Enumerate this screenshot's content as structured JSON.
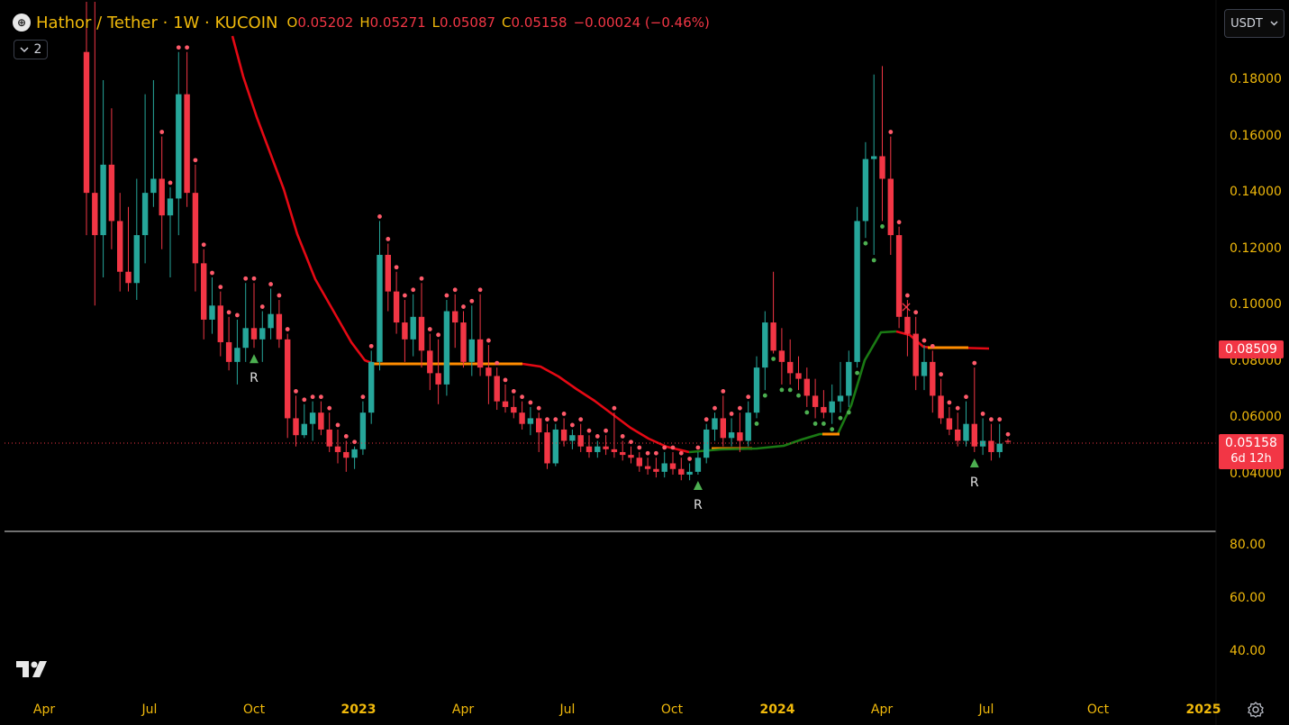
{
  "header": {
    "symbol_icon": "hathor-logo-icon",
    "title": "Hathor / Tether · 1W · KUCOIN",
    "open_label": "O",
    "open_value": "0.05202",
    "high_label": "H",
    "high_value": "0.05271",
    "low_label": "L",
    "low_value": "0.05087",
    "close_label": "C",
    "close_value": "0.05158",
    "change": "−0.00024 (−0.46%)"
  },
  "indicator_toggle": {
    "icon": "chevron-down-icon",
    "count": "2"
  },
  "currency_selector": {
    "value": "USDT",
    "icon": "chevron-down-icon"
  },
  "price_axis": [
    "0.18000",
    "0.16000",
    "0.14000",
    "0.12000",
    "0.10000",
    "0.08000",
    "0.06000",
    "0.04000"
  ],
  "price_tags": {
    "indicator": "0.08509",
    "last_price": "0.05158",
    "countdown": "6d 12h"
  },
  "oscillator_axis": [
    "80.00",
    "60.00",
    "40.00"
  ],
  "time_axis": [
    {
      "label": "Apr",
      "bold": false
    },
    {
      "label": "Jul",
      "bold": false
    },
    {
      "label": "Oct",
      "bold": false
    },
    {
      "label": "2023",
      "bold": true
    },
    {
      "label": "Apr",
      "bold": false
    },
    {
      "label": "Jul",
      "bold": false
    },
    {
      "label": "Oct",
      "bold": false
    },
    {
      "label": "2024",
      "bold": true
    },
    {
      "label": "Apr",
      "bold": false
    },
    {
      "label": "Jul",
      "bold": false
    },
    {
      "label": "Oct",
      "bold": false
    },
    {
      "label": "2025",
      "bold": true
    }
  ],
  "markers": {
    "reversal_label": "R",
    "cross_label": "×"
  },
  "colors": {
    "up": "#26a69a",
    "down": "#f23645",
    "accent": "#f0b90b",
    "trend_down": "#e50914",
    "trend_up": "#1a7a14",
    "trend_flat": "#ff8c00"
  },
  "chart_data": {
    "type": "candlestick",
    "interval": "1W",
    "y_range": [
      0.03,
      0.19
    ],
    "candles": [
      [
        0.19,
        0.25,
        0.125,
        0.14
      ],
      [
        0.14,
        0.23,
        0.1,
        0.125
      ],
      [
        0.125,
        0.18,
        0.11,
        0.15
      ],
      [
        0.15,
        0.17,
        0.12,
        0.13
      ],
      [
        0.13,
        0.14,
        0.105,
        0.112
      ],
      [
        0.112,
        0.135,
        0.105,
        0.108
      ],
      [
        0.108,
        0.145,
        0.102,
        0.125
      ],
      [
        0.125,
        0.175,
        0.115,
        0.14
      ],
      [
        0.14,
        0.18,
        0.135,
        0.145
      ],
      [
        0.145,
        0.16,
        0.12,
        0.132
      ],
      [
        0.132,
        0.142,
        0.11,
        0.138
      ],
      [
        0.138,
        0.19,
        0.125,
        0.175
      ],
      [
        0.175,
        0.19,
        0.135,
        0.14
      ],
      [
        0.14,
        0.15,
        0.105,
        0.115
      ],
      [
        0.115,
        0.12,
        0.088,
        0.095
      ],
      [
        0.095,
        0.11,
        0.09,
        0.1
      ],
      [
        0.1,
        0.105,
        0.082,
        0.087
      ],
      [
        0.087,
        0.096,
        0.077,
        0.08
      ],
      [
        0.08,
        0.095,
        0.072,
        0.085
      ],
      [
        0.085,
        0.108,
        0.08,
        0.092
      ],
      [
        0.092,
        0.108,
        0.085,
        0.088
      ],
      [
        0.088,
        0.098,
        0.08,
        0.092
      ],
      [
        0.092,
        0.106,
        0.088,
        0.097
      ],
      [
        0.097,
        0.102,
        0.085,
        0.088
      ],
      [
        0.088,
        0.09,
        0.053,
        0.06
      ],
      [
        0.06,
        0.068,
        0.05,
        0.054
      ],
      [
        0.054,
        0.065,
        0.053,
        0.058
      ],
      [
        0.058,
        0.066,
        0.052,
        0.062
      ],
      [
        0.062,
        0.066,
        0.054,
        0.056
      ],
      [
        0.056,
        0.062,
        0.048,
        0.05
      ],
      [
        0.05,
        0.056,
        0.044,
        0.048
      ],
      [
        0.048,
        0.052,
        0.041,
        0.046
      ],
      [
        0.046,
        0.05,
        0.042,
        0.049
      ],
      [
        0.049,
        0.066,
        0.047,
        0.062
      ],
      [
        0.062,
        0.084,
        0.058,
        0.08
      ],
      [
        0.08,
        0.13,
        0.077,
        0.118
      ],
      [
        0.118,
        0.122,
        0.098,
        0.105
      ],
      [
        0.105,
        0.112,
        0.09,
        0.094
      ],
      [
        0.094,
        0.102,
        0.08,
        0.088
      ],
      [
        0.088,
        0.104,
        0.082,
        0.096
      ],
      [
        0.096,
        0.108,
        0.078,
        0.084
      ],
      [
        0.084,
        0.09,
        0.07,
        0.076
      ],
      [
        0.076,
        0.088,
        0.065,
        0.072
      ],
      [
        0.072,
        0.102,
        0.068,
        0.098
      ],
      [
        0.098,
        0.104,
        0.085,
        0.094
      ],
      [
        0.094,
        0.098,
        0.078,
        0.08
      ],
      [
        0.08,
        0.1,
        0.075,
        0.088
      ],
      [
        0.088,
        0.104,
        0.075,
        0.078
      ],
      [
        0.078,
        0.086,
        0.065,
        0.075
      ],
      [
        0.075,
        0.078,
        0.063,
        0.066
      ],
      [
        0.066,
        0.072,
        0.062,
        0.064
      ],
      [
        0.064,
        0.068,
        0.06,
        0.062
      ],
      [
        0.062,
        0.066,
        0.056,
        0.058
      ],
      [
        0.058,
        0.064,
        0.054,
        0.06
      ],
      [
        0.06,
        0.062,
        0.048,
        0.055
      ],
      [
        0.055,
        0.058,
        0.042,
        0.044
      ],
      [
        0.044,
        0.058,
        0.043,
        0.056
      ],
      [
        0.056,
        0.06,
        0.05,
        0.052
      ],
      [
        0.052,
        0.056,
        0.049,
        0.054
      ],
      [
        0.054,
        0.058,
        0.048,
        0.05
      ],
      [
        0.05,
        0.054,
        0.046,
        0.048
      ],
      [
        0.048,
        0.052,
        0.046,
        0.05
      ],
      [
        0.05,
        0.054,
        0.047,
        0.049
      ],
      [
        0.049,
        0.062,
        0.046,
        0.048
      ],
      [
        0.048,
        0.052,
        0.045,
        0.047
      ],
      [
        0.047,
        0.05,
        0.044,
        0.046
      ],
      [
        0.046,
        0.048,
        0.041,
        0.043
      ],
      [
        0.043,
        0.046,
        0.04,
        0.042
      ],
      [
        0.042,
        0.046,
        0.039,
        0.041
      ],
      [
        0.041,
        0.048,
        0.039,
        0.044
      ],
      [
        0.044,
        0.048,
        0.04,
        0.042
      ],
      [
        0.042,
        0.046,
        0.038,
        0.04
      ],
      [
        0.04,
        0.044,
        0.038,
        0.041
      ],
      [
        0.041,
        0.048,
        0.04,
        0.046
      ],
      [
        0.046,
        0.058,
        0.044,
        0.056
      ],
      [
        0.056,
        0.062,
        0.052,
        0.06
      ],
      [
        0.06,
        0.068,
        0.05,
        0.053
      ],
      [
        0.053,
        0.06,
        0.05,
        0.055
      ],
      [
        0.055,
        0.062,
        0.048,
        0.052
      ],
      [
        0.052,
        0.066,
        0.05,
        0.062
      ],
      [
        0.062,
        0.082,
        0.06,
        0.078
      ],
      [
        0.078,
        0.098,
        0.07,
        0.094
      ],
      [
        0.094,
        0.112,
        0.083,
        0.084
      ],
      [
        0.084,
        0.092,
        0.072,
        0.08
      ],
      [
        0.08,
        0.088,
        0.072,
        0.076
      ],
      [
        0.076,
        0.082,
        0.07,
        0.074
      ],
      [
        0.074,
        0.078,
        0.064,
        0.068
      ],
      [
        0.068,
        0.074,
        0.06,
        0.064
      ],
      [
        0.064,
        0.07,
        0.06,
        0.062
      ],
      [
        0.062,
        0.072,
        0.058,
        0.066
      ],
      [
        0.066,
        0.08,
        0.062,
        0.068
      ],
      [
        0.068,
        0.084,
        0.064,
        0.08
      ],
      [
        0.08,
        0.135,
        0.078,
        0.13
      ],
      [
        0.13,
        0.158,
        0.124,
        0.152
      ],
      [
        0.152,
        0.182,
        0.118,
        0.153
      ],
      [
        0.153,
        0.185,
        0.13,
        0.145
      ],
      [
        0.145,
        0.16,
        0.118,
        0.125
      ],
      [
        0.125,
        0.128,
        0.092,
        0.096
      ],
      [
        0.096,
        0.102,
        0.082,
        0.09
      ],
      [
        0.09,
        0.096,
        0.07,
        0.075
      ],
      [
        0.075,
        0.086,
        0.07,
        0.08
      ],
      [
        0.08,
        0.084,
        0.062,
        0.068
      ],
      [
        0.068,
        0.074,
        0.058,
        0.06
      ],
      [
        0.06,
        0.064,
        0.054,
        0.056
      ],
      [
        0.056,
        0.062,
        0.05,
        0.052
      ],
      [
        0.052,
        0.066,
        0.05,
        0.058
      ],
      [
        0.058,
        0.078,
        0.048,
        0.05
      ],
      [
        0.05,
        0.06,
        0.047,
        0.052
      ],
      [
        0.052,
        0.058,
        0.045,
        0.048
      ],
      [
        0.048,
        0.058,
        0.046,
        0.051
      ],
      [
        0.05202,
        0.05271,
        0.05087,
        0.05158
      ]
    ],
    "last_price": 0.05158,
    "indicator_last": 0.08509,
    "reversal_signals": [
      {
        "index": 20,
        "label": "R"
      },
      {
        "index": 73,
        "label": "R"
      },
      {
        "index": 106,
        "label": "R"
      }
    ],
    "cross_signal": {
      "index": 97
    }
  }
}
